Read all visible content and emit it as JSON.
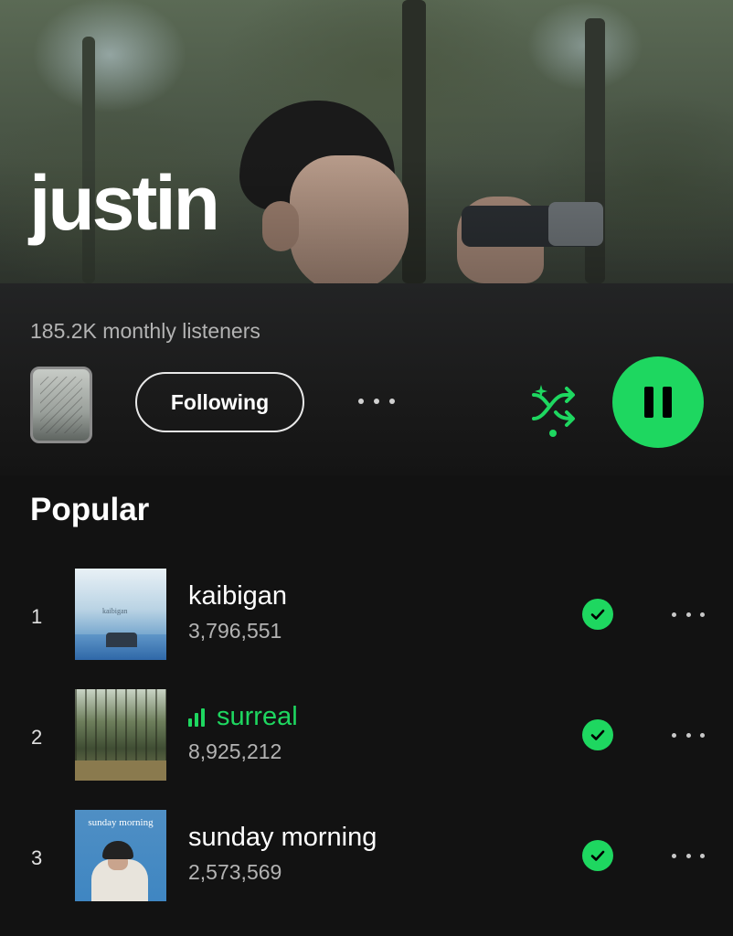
{
  "artist": {
    "name": "justin",
    "monthly_listeners": "185.2K monthly listeners"
  },
  "controls": {
    "follow_label": "Following",
    "shuffle_icon": "shuffle-icon",
    "play_state": "pause-icon"
  },
  "popular": {
    "title": "Popular",
    "tracks": [
      {
        "rank": "1",
        "title": "kaibigan",
        "plays": "3,796,551",
        "playing": false,
        "art_text": "kaibigan"
      },
      {
        "rank": "2",
        "title": "surreal",
        "plays": "8,925,212",
        "playing": true,
        "art_text": ""
      },
      {
        "rank": "3",
        "title": "sunday morning",
        "plays": "2,573,569",
        "playing": false,
        "art_text": "sunday morning"
      }
    ]
  },
  "colors": {
    "accent": "#1ed760",
    "background": "#121212",
    "secondary_text": "#b3b3b3"
  }
}
